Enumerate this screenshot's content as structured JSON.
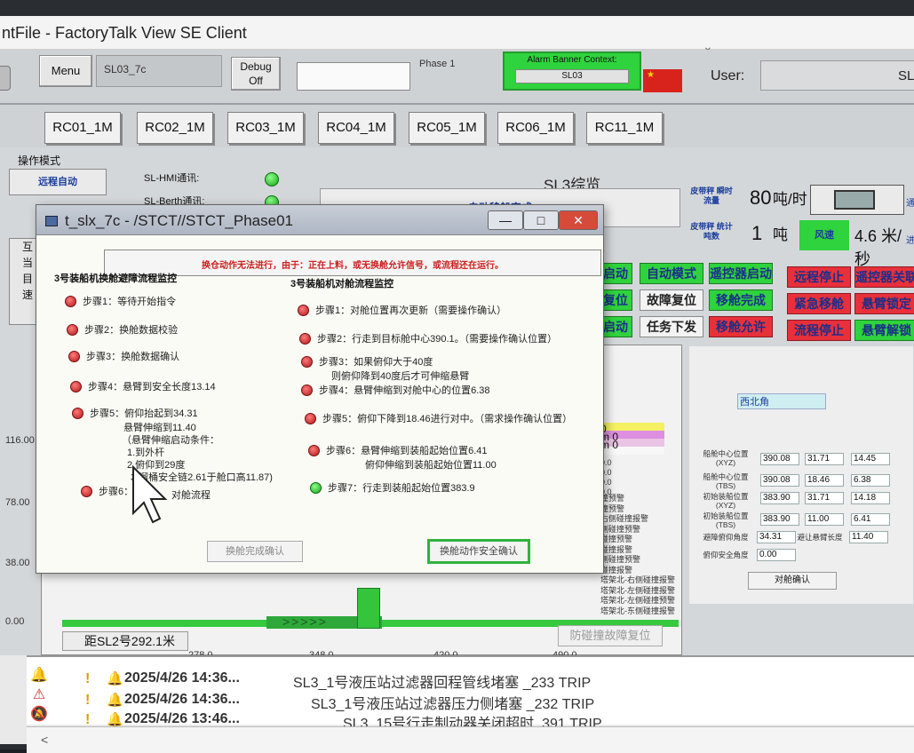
{
  "app": {
    "title": "ntFile - FactoryTalk View SE Client"
  },
  "toolbar": {
    "menu_label": "Menu",
    "screen_name": "SL03_7c",
    "debug_label_line1": "Debug",
    "debug_label_line2": "Off",
    "phase_label": "Phase 1",
    "alarm_context_label": "Alarm Banner Context:",
    "alarm_context_value": "SL03",
    "user_label": "User:",
    "user_value": "SL"
  },
  "tabs": [
    "RC01_1M",
    "RC02_1M",
    "RC03_1M",
    "RC04_1M",
    "RC05_1M",
    "RC06_1M",
    "RC11_1M"
  ],
  "hmi": {
    "op_mode_label": "操作模式",
    "remote_auto_label": "远程自动",
    "hmi_comm_label": "SL-HMI通讯:",
    "berth_comm_label": "SL-Berth通讯:",
    "overview_title": "SL3综览",
    "status_text": "自动移船完成",
    "belt_flow_label": "皮带秤 瞬时流量",
    "belt_flow_value": "80",
    "belt_flow_unit": "吨/时",
    "belt_total_label": "皮带秤 统计吨数",
    "belt_total_value": "1",
    "belt_total_unit": "吨",
    "wind_badge": "风速",
    "wind_speed": "4.6 米/秒",
    "edge_text_1": "通",
    "edge_text_2": "进",
    "left_partial": [
      "互",
      "当",
      "目",
      "速"
    ],
    "commands": [
      {
        "label": "启动",
        "style": "green"
      },
      {
        "label": "自动模式",
        "style": "green"
      },
      {
        "label": "遥控器启动",
        "style": "green"
      },
      {
        "label": "远程停止",
        "style": "red"
      },
      {
        "label": "遥控器关联",
        "style": "red"
      },
      {
        "label": "复位",
        "style": "green"
      },
      {
        "label": "故障复位",
        "style": "white"
      },
      {
        "label": "移舱完成",
        "style": "green"
      },
      {
        "label": "紧急移舱",
        "style": "red"
      },
      {
        "label": "悬臂锁定",
        "style": "red"
      },
      {
        "label": "启动",
        "style": "green"
      },
      {
        "label": "任务下发",
        "style": "white"
      },
      {
        "label": "移舱允许",
        "style": "red"
      },
      {
        "label": "流程停止",
        "style": "red"
      },
      {
        "label": "悬臂解锁",
        "style": "green"
      }
    ]
  },
  "scene": {
    "y_ticks": [
      "116.00",
      "78.00",
      "38.00",
      "0.00"
    ],
    "x_ticks": [
      "278.0",
      "348.0",
      "420.0",
      "490.0"
    ],
    "distance_label": "距SL2号292.1米",
    "anti_collision_label": "防碰撞故障复位",
    "stack_labels": [
      "0",
      "m 0",
      "m 0",
      "",
      "0.0",
      "0.0",
      "0.0",
      "0.0"
    ],
    "alarm_list": [
      "撞预警",
      "撞预警",
      "右侧碰撞报警",
      "侧碰撞预警",
      "碰撞预警",
      "碰撞报警",
      "侧碰撞预警",
      "碰撞报警",
      "塔架北-右侧碰撞报警",
      "塔架北-左侧碰撞报警",
      "塔架北-左侧碰撞预警",
      "塔架北-东侧碰撞报警"
    ]
  },
  "coords": {
    "section_label": "西北角",
    "rows": [
      {
        "label": "船舱中心位置 (XYZ)",
        "values": [
          "390.08",
          "31.71",
          "14.45"
        ]
      },
      {
        "label": "船舱中心位置 (TBS)",
        "values": [
          "390.08",
          "18.46",
          "6.38"
        ]
      },
      {
        "label": "初始装船位置 (XYZ)",
        "values": [
          "383.90",
          "31.71",
          "14.18"
        ]
      },
      {
        "label": "初始装船位置 (TBS)",
        "values": [
          "383.90",
          "11.00",
          "6.41"
        ]
      }
    ],
    "lift_label": "避障俯仰角度",
    "lift_value": "34.31",
    "boom_label": "避让悬臂长度",
    "boom_value": "11.40",
    "safe_label": "俯仰安全角度",
    "safe_value": "0.00",
    "confirm_label": "对舱确认"
  },
  "dialog": {
    "title": "t_slx_7c - /STCT//STCT_Phase01",
    "min_symbol": "—",
    "max_symbol": "□",
    "close_symbol": "✕",
    "warning": "换仓动作无法进行，由于：正在上料，或无换舱允许信号，或流程还在运行。",
    "left_title": "3号装船机换舱避障流程监控",
    "right_title": "3号装船机对舱流程监控",
    "left_steps": [
      {
        "text": "步骤1：等待开始指令",
        "state": "red"
      },
      {
        "text": "步骤2：换舱数据校验",
        "state": "red"
      },
      {
        "text": "步骤3：换舱数据确认",
        "state": "red"
      },
      {
        "text": "步骤4：悬臂到安全长度13.14",
        "state": "red"
      },
      {
        "text": "步骤5：俯仰抬起到34.31",
        "state": "red"
      },
      {
        "text": "步骤6：",
        "state": "red"
      }
    ],
    "left_step5_sub": [
      "悬臂伸缩到11.40",
      "（悬臂伸缩启动条件：",
      "1.到外杆",
      "2.俯仰到29度",
      "3.溜桶安全链2.61于舱口高11.87)"
    ],
    "left_step6_tail": "对舱流程",
    "right_steps": [
      {
        "text": "步骤1：对舱位置再次更新（需要操作确认）",
        "state": "red"
      },
      {
        "text": "步骤2：行走到目标舱中心390.1。（需要操作确认位置）",
        "state": "red"
      },
      {
        "text": "步骤3：如果俯仰大于40度",
        "state": "red"
      },
      {
        "text": "步骤4：悬臂伸缩到对舱中心的位置6.38",
        "state": "red"
      },
      {
        "text": "步骤5：俯仰下降到18.46进行对中。（需求操作确认位置）",
        "state": "red"
      },
      {
        "text": "步骤6：悬臂伸缩到装船起始位置6.41",
        "state": "red"
      },
      {
        "text": "步骤7：行走到装船起始位置383.9",
        "state": "green"
      }
    ],
    "right_step3_sub": "则俯仰降到40度后才可伸缩悬臂",
    "right_step6_sub": "俯仰伸缩到装船起始位置11.00",
    "swap_complete_label": "换舱完成确认",
    "swap_safe_label": "换舱动作安全确认"
  },
  "alarms": [
    {
      "time": "2025/4/26 14:36...",
      "message": "SL3_1号液压站过滤器回程管线堵塞 _233 TRIP"
    },
    {
      "time": "2025/4/26 14:36...",
      "message": "SL3_1号液压站过滤器压力侧堵塞 _232 TRIP"
    },
    {
      "time": "2025/4/26 13:46...",
      "message": "SL3_15号行走制动器关闭超时_391 TRIP"
    }
  ]
}
